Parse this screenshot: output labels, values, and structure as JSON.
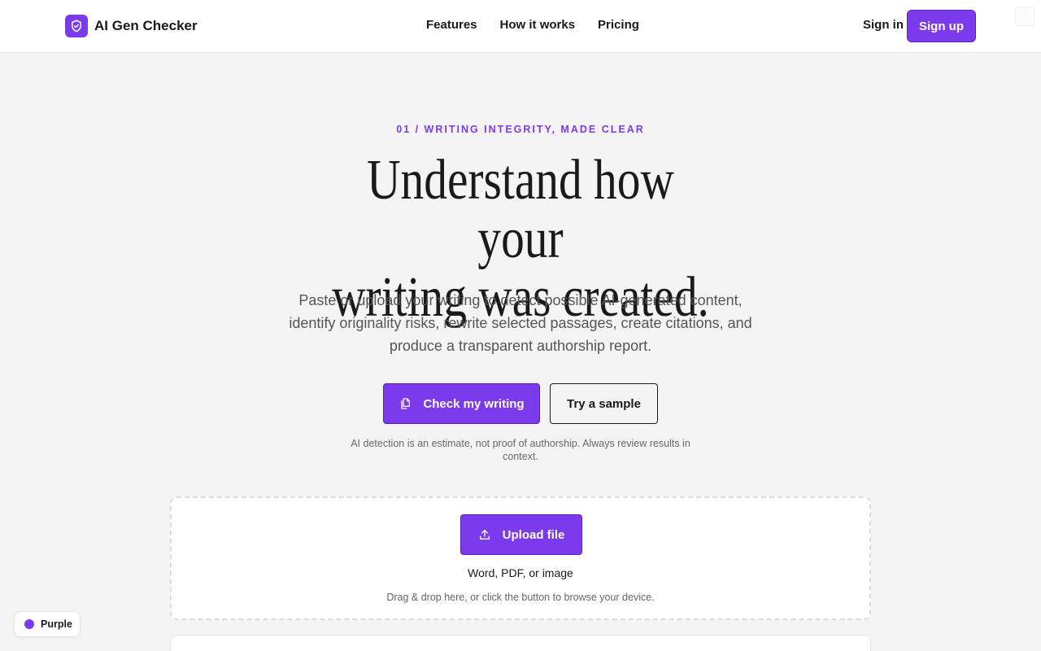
{
  "header": {
    "brand_name": "AI Gen Checker",
    "nav": [
      "Features",
      "How it works",
      "Pricing"
    ],
    "signin_label": "Sign in",
    "signup_label": "Sign up"
  },
  "hero": {
    "eyebrow": "01 / WRITING INTEGRITY, MADE CLEAR",
    "title_line1": "Understand how your",
    "title_line2": "writing was created.",
    "subtitle": "Paste or upload your writing to detect possible AI-generated content, identify originality risks, rewrite selected passages, create citations, and produce a transparent authorship report.",
    "primary_cta": "Check my writing",
    "secondary_cta": "Try a sample",
    "disclaimer": "AI detection is an estimate, not proof of authorship. Always review results in context."
  },
  "upload": {
    "button_label": "Upload file",
    "formats": "Word, PDF, or image",
    "hint": "Drag & drop here, or click the button to browse your device."
  },
  "theme": {
    "label": "Purple",
    "color": "#7c3aed"
  },
  "icons": {
    "brand": "shield-check-icon",
    "check_writing": "document-copy-icon",
    "upload": "upload-icon"
  }
}
